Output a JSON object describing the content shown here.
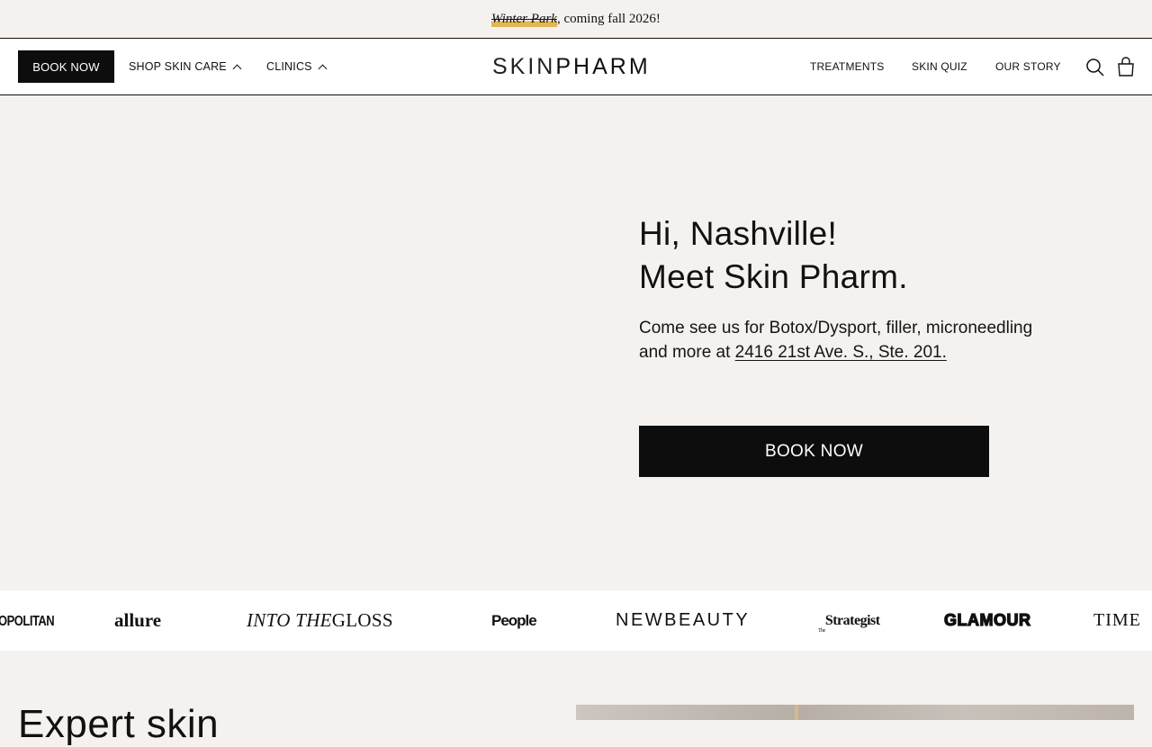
{
  "announcement": {
    "highlight": "Winter Park",
    "rest": ", coming fall 2026!"
  },
  "header": {
    "book_label": "BOOK NOW",
    "shop_label": "SHOP SKIN CARE",
    "clinics_label": "CLINICS",
    "logo_bold": "SKIN",
    "logo_rest": "PHARM",
    "treatments_label": "TREATMENTS",
    "quiz_label": "SKIN QUIZ",
    "story_label": "OUR STORY",
    "icons": [
      "search-icon",
      "bag-icon",
      "chevron-up-icon"
    ]
  },
  "hero": {
    "title_line1": "Hi, Nashville!",
    "title_line2": "Meet Skin Pharm.",
    "desc_text": "Come see us for Botox/Dysport, filler, microneedling and more at ",
    "address_link": "2416 21st Ave. S., Ste. 201.",
    "book_label": "BOOK NOW"
  },
  "press": {
    "cosmo": "OPOLITAN",
    "allure": "allure",
    "itg_italic": "INTO THE",
    "itg_rest": " GLOSS",
    "people": "People",
    "newbeauty": "NEWBEAUTY",
    "strategist": "Strategist",
    "strategist_the": "The",
    "glamour": "GLAMOUR",
    "time": "TIME"
  },
  "bottom": {
    "title": "Expert skin"
  },
  "colors": {
    "background": "#f5f1ef",
    "black": "#0d0d0d",
    "highlight": "#e3b651"
  }
}
